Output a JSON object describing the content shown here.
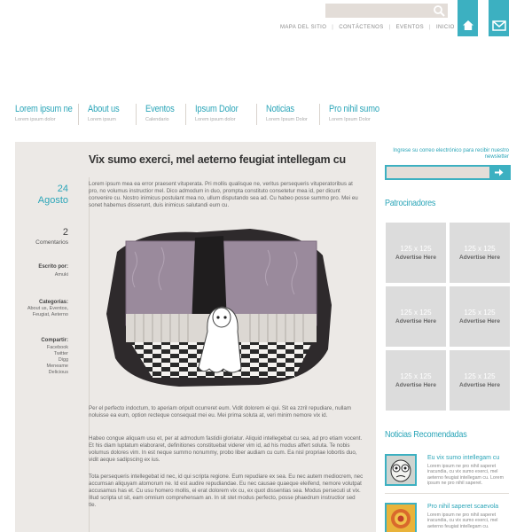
{
  "topbar": {
    "search_placeholder": "",
    "links": [
      "MAPA DEL SITIO",
      "CONTÁCTENOS",
      "EVENTOS",
      "INICIO"
    ]
  },
  "nav": [
    {
      "title": "Lorem ipsum ne",
      "sub": "Lorem ipsum dolor"
    },
    {
      "title": "About us",
      "sub": "Lorem ipsum"
    },
    {
      "title": "Eventos",
      "sub": "Calendario"
    },
    {
      "title": "Ipsum Dolor",
      "sub": "Lorem ipsum dolor"
    },
    {
      "title": "Noticias",
      "sub": "Lorem Ipsum Dolor"
    },
    {
      "title": "Pro nihil sumo",
      "sub": "Lorem Ipsum Dolor"
    }
  ],
  "post": {
    "title": "Vix sumo exerci, mel aeterno feugiat intellegam cu",
    "day": "24",
    "month": "Agosto",
    "comments_count": "2",
    "comments_label": "Comentarios",
    "author_label": "Escrito por:",
    "author": "Amuki",
    "categories_label": "Categorías:",
    "categories": [
      "About us, Eventos,",
      "Feugiat, Aeterno"
    ],
    "share_label": "Compartir:",
    "share": [
      "Facebook",
      "Twitter",
      "Digg",
      "Meneame",
      "Delicious"
    ],
    "para1": "Lorem ipsum mea ea error praesent vituperata. Pri mollis qualisque ne, veritus persequeris vituperatoribus at pro, no volumus instructior mel. Dico admodum in duo, prompta constituto consetetur mea id, per dicunt convenire cu. Nostro inimicus postulant mea no, ullum disputando sea ad. Cu habeo posse summo pro. Mei eu sonet habemus disserunt, duis inimicus salutandi eum cu.",
    "para2": "Per el perfecto indoctum, to aperiam oripult ocurreret eum. Vidit dolorem ei qui. Sit ea zzril repudiare, nullam noluisse ea eum, option recteque consequat mei eu. Mei prima soluta at, veri minim nemore vix id.",
    "para3": "Habeo congue aliquam usu et, per at admodum fastidii gloriatur. Aliquid intellegebat cu sea, ad pro etiam vocent. Et his diam luptatum elaboraret, definitiones constituebat viderer vim id, ad his modus affert soluta. Te nobis volumus dolores vim. In est neque summo nonummy, probo liber audiam cu cum. Ea nisl propriae lobortis duo, vidit aeque sadipscing ex ius.",
    "para4": "Tota persequeris intellegebat id nec, id qui scripta regione. Eum repudiare ex sea. Eu nec autem mediocrem, nec accumsan aliquyam atomorum ne. Id est audire repudiandae. Eu nec causae quaeque eleifend, nemore volutpat accusamus has et. Cu usu homero mollis, ei erat dolorem vix cu, ex quot dissentias sea. Modus persecuti ut vix. Illud scripta ut sit, eam omnium comprehensam an. In sit stet modus perfecto, posse phaedrum instructior sed tle."
  },
  "sidebar": {
    "newsletter_text": "Ingrese su correo electrónico para recibir nuestro newsletter",
    "sponsors_title": "Patrocinadores",
    "ad_size": "125 x 125",
    "ad_label": "Advertise Here",
    "news_title": "Noticias Recomendadas",
    "news": [
      {
        "title": "Eu vix sumo intellegam cu",
        "text": "Lorem ipsum ne pro nihil saperet iracundia, cu vix sumo exerci, mel aeterno feugiat intellegam cu. Lorem ipsum ne pro nihil saperet."
      },
      {
        "title": "Pro nihil saperet scaevola",
        "text": "Lorem ipsum ne pro nihil saperet iracundia, cu vix sumo exerci, mel aeterno feugiat intellegam cu."
      }
    ]
  },
  "colors": {
    "accent": "#3cb0c1",
    "panel": "#ece9e6",
    "search_bg": "#e3ddd8"
  }
}
